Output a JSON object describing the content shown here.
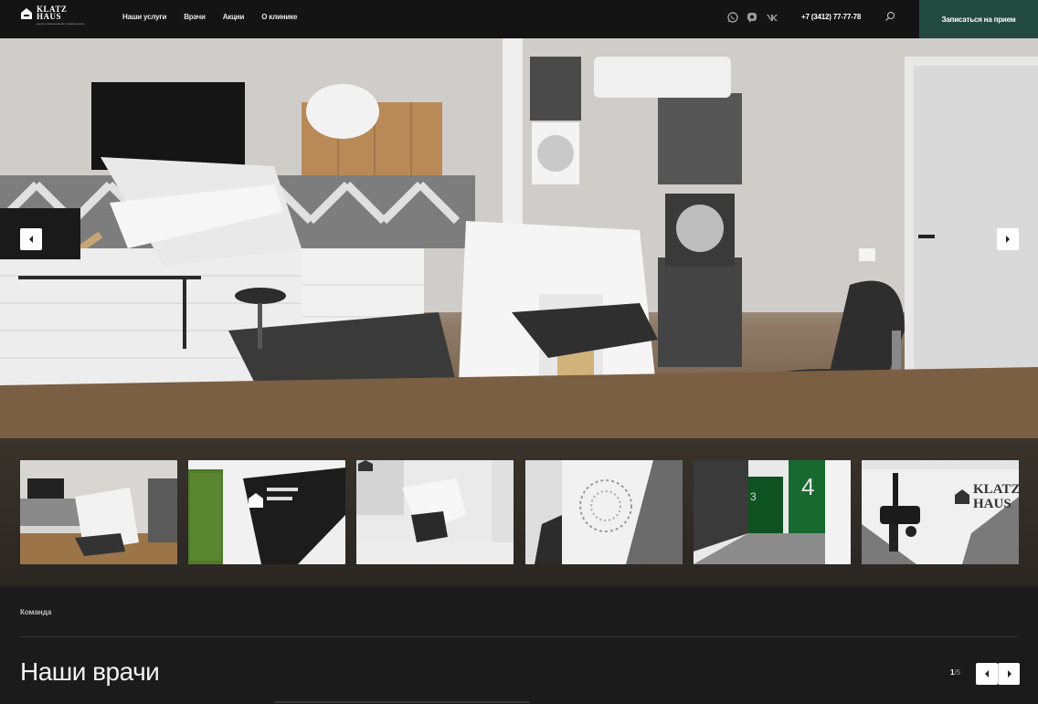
{
  "header": {
    "logo_line1": "KLATZ",
    "logo_line2": "HAUS",
    "logo_sub": "центр клинической стоматологии",
    "nav": [
      "Наши услуги",
      "Врачи",
      "Акции",
      "О клинике"
    ],
    "social_icons": [
      "whatsapp-icon",
      "viber-icon",
      "vk-icon"
    ],
    "phone": "+7 (3412) 77-77-78",
    "cta": "Записаться на прием",
    "accent_color": "#234a40"
  },
  "hero": {
    "prev_icon": "chevron-left-icon",
    "next_icon": "chevron-right-icon"
  },
  "thumbs": [
    {
      "alt": "dental-office"
    },
    {
      "alt": "reception-logo-wall"
    },
    {
      "alt": "dental-chair-room"
    },
    {
      "alt": "corridor-mirror"
    },
    {
      "alt": "hallway-green-doors",
      "number": "4",
      "number2": "3"
    },
    {
      "alt": "microscope-logo-wall",
      "logo_text1": "KLATZ",
      "logo_text2": "HAUS"
    }
  ],
  "team": {
    "label": "Команда",
    "title": "Наши врачи",
    "page_current": "1",
    "page_total": "/5"
  }
}
